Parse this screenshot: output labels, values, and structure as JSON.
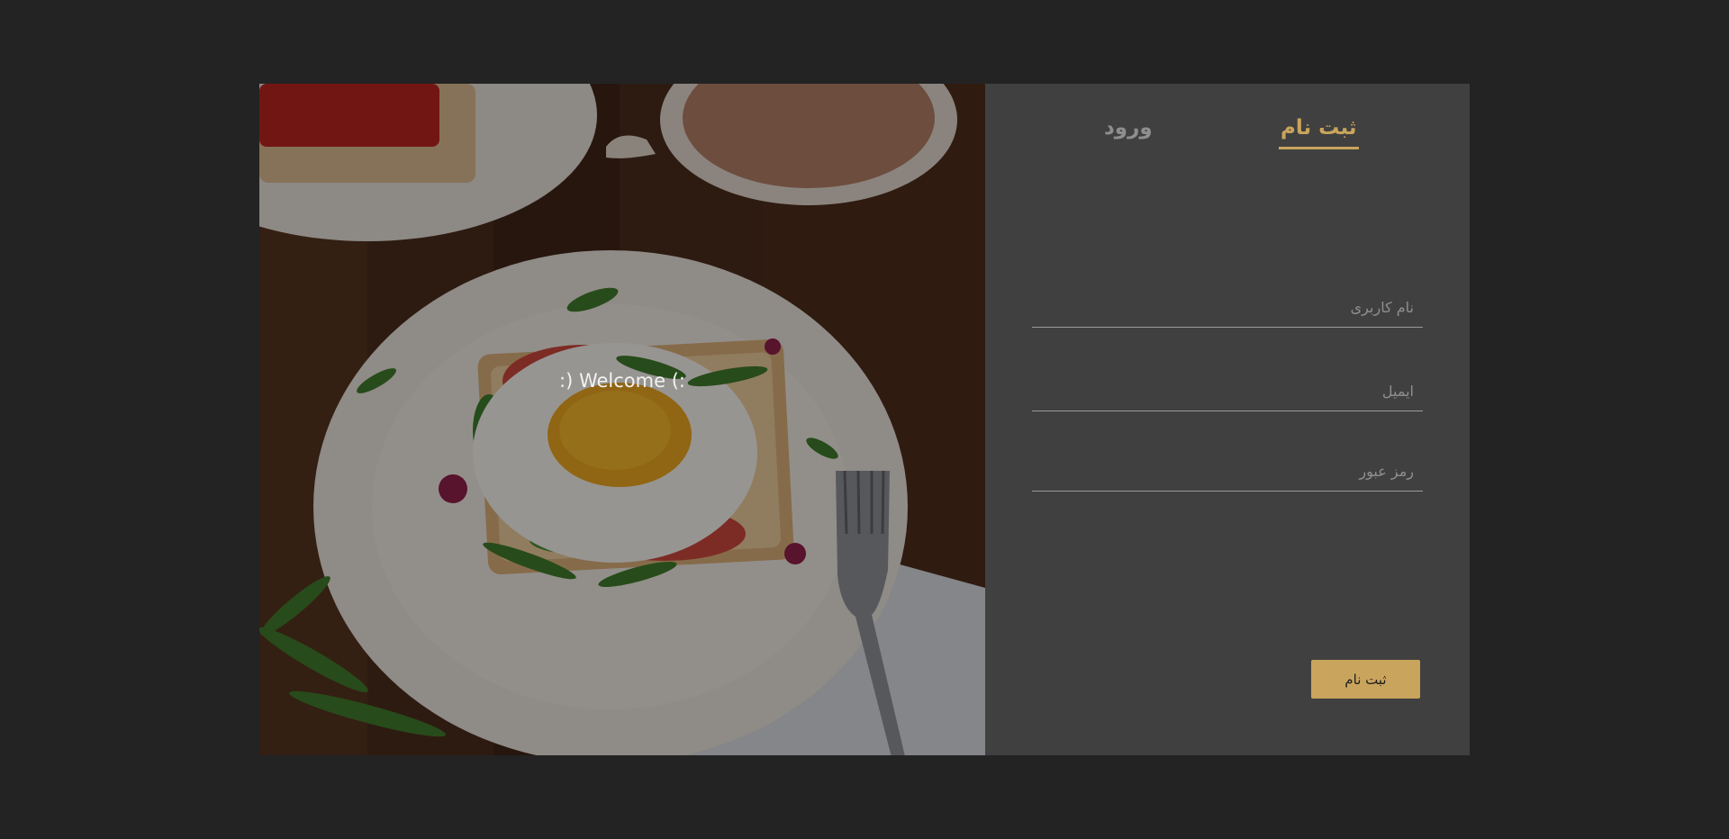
{
  "hero": {
    "welcome_text": ":) Welcome (:"
  },
  "tabs": {
    "signup_label": "ثبت نام",
    "login_label": "ورود"
  },
  "form": {
    "username_placeholder": "نام کاربری",
    "email_placeholder": "ایمیل",
    "password_placeholder": "رمز عبور",
    "submit_label": "ثبت نام"
  },
  "colors": {
    "page_background": "#232323",
    "panel_background": "#404040",
    "accent": "#c9a45c",
    "inactive_tab": "#8e8e8e"
  }
}
